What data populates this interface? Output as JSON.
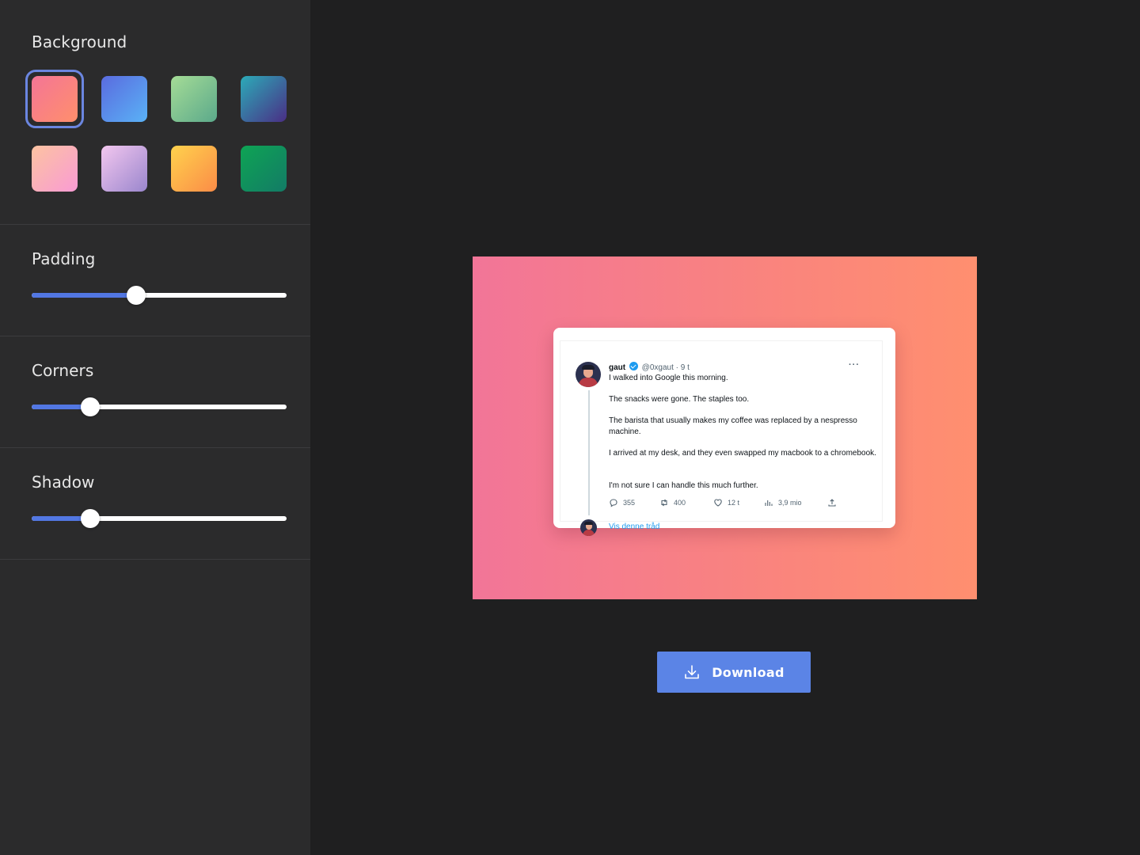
{
  "sidebar": {
    "background": {
      "title": "Background",
      "swatches": [
        {
          "name": "salmon",
          "from": "#f47596",
          "to": "#ff8f6c",
          "selected": true
        },
        {
          "name": "blue",
          "from": "#5a6bdf",
          "to": "#5ab2f6",
          "selected": false
        },
        {
          "name": "mint",
          "from": "#a5dc96",
          "to": "#5ba98b",
          "selected": false
        },
        {
          "name": "teal-indigo",
          "from": "#2cabb8",
          "to": "#4a2e85",
          "selected": false
        },
        {
          "name": "peach-pink",
          "from": "#fcc3a1",
          "to": "#f99bd4",
          "selected": false
        },
        {
          "name": "lavender",
          "from": "#f3c7ef",
          "to": "#9a86cd",
          "selected": false
        },
        {
          "name": "amber",
          "from": "#ffd24d",
          "to": "#fb8c47",
          "selected": false
        },
        {
          "name": "green",
          "from": "#0ea454",
          "to": "#137b66",
          "selected": false
        }
      ]
    },
    "padding": {
      "title": "Padding",
      "value_percent": 41
    },
    "corners": {
      "title": "Corners",
      "value_percent": 23
    },
    "shadow": {
      "title": "Shadow",
      "value_percent": 23
    }
  },
  "tweet": {
    "name": "gaut",
    "handle_time": "@0xgaut · 9 t",
    "more": "···",
    "lines": [
      "I walked into Google this morning.",
      "The snacks were gone. The staples too.",
      "The barista that usually makes my coffee was replaced by a nespresso machine.",
      "I arrived at my desk, and they even swapped my macbook to a chromebook.",
      "I'm not sure I can handle this much further."
    ],
    "replies": "355",
    "retweets": "400",
    "likes": "12 t",
    "views": "3,9 mio",
    "show_thread": "Vis denne tråd"
  },
  "actions": {
    "download_label": "Download"
  },
  "colors": {
    "accent": "#5b84e6",
    "slider_fill": "#5277e3",
    "sidebar_bg": "#2b2b2c",
    "canvas_bg": "#1f1f20"
  }
}
